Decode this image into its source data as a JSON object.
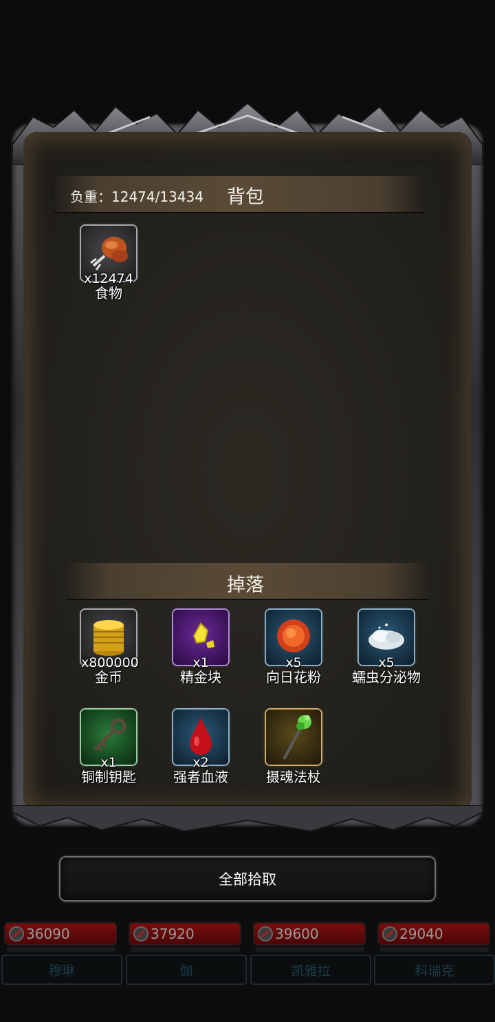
{
  "inventory": {
    "weight_text": "负重：12474/13434",
    "title": "背包",
    "items": [
      {
        "icon": "meat-icon",
        "qty": "x12474",
        "name": "食物"
      }
    ]
  },
  "drops": {
    "title": "掉落",
    "items": [
      {
        "icon": "gold-coins-icon",
        "qty": "x800000",
        "name": "金币"
      },
      {
        "icon": "gold-nugget-icon",
        "qty": "x1",
        "name": "精金块"
      },
      {
        "icon": "pollen-icon",
        "qty": "x5",
        "name": "向日花粉"
      },
      {
        "icon": "secretion-icon",
        "qty": "x5",
        "name": "蠕虫分泌物"
      },
      {
        "icon": "key-icon",
        "qty": "x1",
        "name": "铜制钥匙"
      },
      {
        "icon": "blood-drop-icon",
        "qty": "x2",
        "name": "强者血液"
      },
      {
        "icon": "staff-icon",
        "qty": "",
        "name": "摄魂法杖"
      }
    ]
  },
  "actions": {
    "pickup_all": "全部拾取"
  },
  "party": [
    {
      "hp": "36090",
      "name": "穆琳"
    },
    {
      "hp": "37920",
      "name": "伽"
    },
    {
      "hp": "39600",
      "name": "凯雅拉"
    },
    {
      "hp": "29040",
      "name": "科瑞克"
    }
  ],
  "colors": {
    "panel_bg": "#24221d",
    "hp_bar": "#7a0d0d",
    "slot_purple": "#5a1a8a",
    "slot_green": "#1f6a2a",
    "slot_blue": "#1b4a6a",
    "slot_gold": "#8a6a1a"
  }
}
